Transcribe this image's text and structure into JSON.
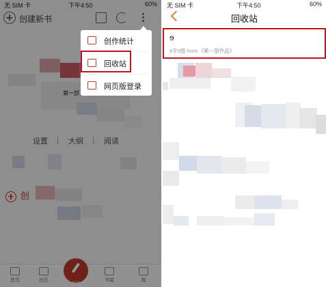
{
  "left": {
    "status": {
      "carrier": "无 SIM 卡",
      "time": "下午4:50",
      "battery": "60%"
    },
    "header": {
      "create_label": "创建新书"
    },
    "book": {
      "title": "第一部"
    },
    "actions": [
      "设置",
      "大纲",
      "阅读"
    ],
    "create_bottom_label": "创",
    "menu": {
      "items": [
        {
          "label": "创作统计",
          "icon": "chart-icon"
        },
        {
          "label": "回收站",
          "icon": "trash-icon"
        },
        {
          "label": "网页版登录",
          "icon": "monitor-icon"
        }
      ]
    },
    "tabbar": [
      "首页",
      "社区",
      "创作",
      "书架",
      "我"
    ]
  },
  "right": {
    "status": {
      "carrier": "无 SIM 卡",
      "time": "下午4:50",
      "battery": "60%"
    },
    "title": "回收站",
    "item": {
      "title": "ɘ",
      "meta": "8字0图 from:《第一部作品》"
    }
  },
  "colors": {
    "accent": "#c0392b",
    "highlight": "#c0151c",
    "back": "#d9822b"
  }
}
